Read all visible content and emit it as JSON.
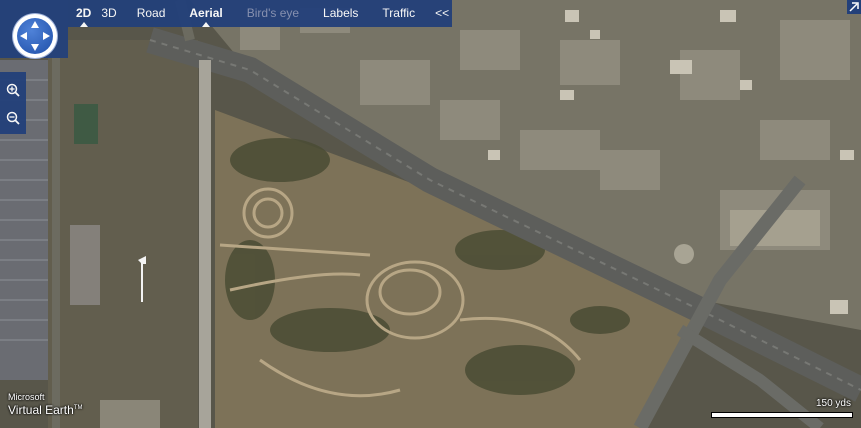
{
  "toolbar": {
    "items": [
      {
        "label": "2D",
        "active": true
      },
      {
        "label": "3D",
        "active": false
      },
      {
        "label": "Road",
        "active": false
      },
      {
        "label": "Aerial",
        "active": true
      },
      {
        "label": "Bird's eye",
        "disabled": true
      },
      {
        "label": "Labels",
        "active": false
      },
      {
        "label": "Traffic",
        "active": false
      }
    ],
    "collapse_label": "<<"
  },
  "map": {
    "type": "aerial",
    "scale_label": "150 yds"
  },
  "branding": {
    "line1": "Microsoft",
    "line2": "Virtual Earth",
    "tm": "TM"
  },
  "icons": {
    "compass": "compass-pan-icon",
    "zoom_in": "zoom-in-icon",
    "zoom_out": "zoom-out-icon",
    "expand": "expand-arrow-icon",
    "pushpin": "pin-icon"
  },
  "colors": {
    "toolbar_bg": "#23407a",
    "compass": "#2f5fb8",
    "terrain": "#7a6f55",
    "road": "#6b6b66",
    "vegetation": "#3e4a2e"
  }
}
